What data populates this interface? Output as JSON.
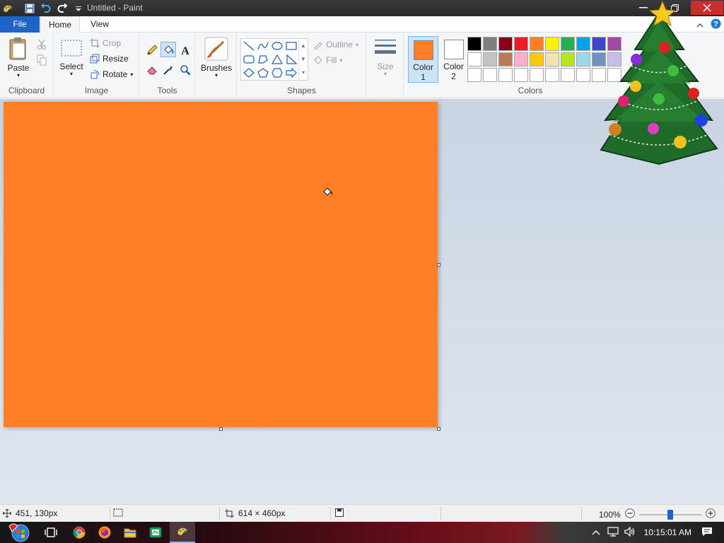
{
  "window": {
    "title": "Untitled - Paint"
  },
  "tabs": {
    "file": "File",
    "home": "Home",
    "view": "View"
  },
  "ribbon": {
    "clipboard": {
      "paste": "Paste",
      "label": "Clipboard"
    },
    "image": {
      "select": "Select",
      "crop": "Crop",
      "resize": "Resize",
      "rotate": "Rotate",
      "label": "Image"
    },
    "tools": {
      "label": "Tools"
    },
    "brushes": {
      "label": "Brushes"
    },
    "shapes": {
      "outline": "Outline",
      "fill": "Fill",
      "label": "Shapes"
    },
    "size": {
      "label": "Size"
    },
    "colors": {
      "color1_l1": "Color",
      "color1_l2": "1",
      "color2_l1": "Color",
      "color2_l2": "2",
      "label": "Colors",
      "color1_value": "#ff7f27",
      "color2_value": "#ffffff",
      "palette_row1": [
        "#000000",
        "#7f7f7f",
        "#880015",
        "#ed1c24",
        "#ff7f27",
        "#fff200",
        "#22b14c",
        "#00a2e8",
        "#3f48cc",
        "#a349a4"
      ],
      "palette_row2": [
        "#ffffff",
        "#c3c3c3",
        "#b97a57",
        "#ffaec9",
        "#ffc90e",
        "#efe4b0",
        "#b5e61d",
        "#99d9ea",
        "#7092be",
        "#c8bfe7"
      ],
      "palette_row3": [
        "#ffffff",
        "#ffffff",
        "#ffffff",
        "#ffffff",
        "#ffffff",
        "#ffffff",
        "#ffffff",
        "#ffffff",
        "#ffffff",
        "#ffffff"
      ]
    }
  },
  "canvas": {
    "fill_color": "#ff7f27"
  },
  "status": {
    "cursor_pos": "451, 130px",
    "image_size": "614 × 460px",
    "zoom": "100%"
  },
  "taskbar": {
    "time": "10:15:01 AM"
  }
}
